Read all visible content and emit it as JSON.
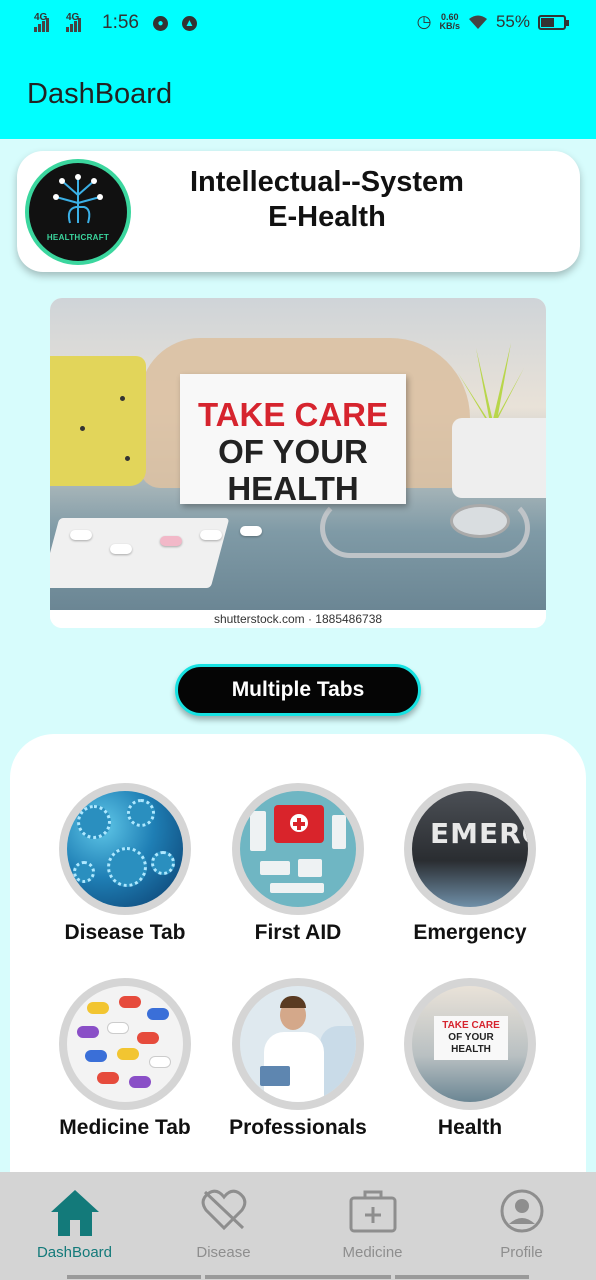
{
  "status_bar": {
    "network1": "4G",
    "network2": "4G",
    "time": "1:56",
    "speed_value": "0.60",
    "speed_unit": "KB/s",
    "battery": "55%",
    "battery_level": 0.55
  },
  "app_bar": {
    "title": "DashBoard"
  },
  "header": {
    "logo_text": "HEALTHCRAFT",
    "title_line1": "Intellectual--System",
    "title_line2": "E-Health"
  },
  "banner": {
    "sign_line1": "TAKE CARE",
    "sign_line2": "OF YOUR",
    "sign_line3": "HEALTH",
    "watermark": "shutterstock.com · 1885486738"
  },
  "tabs_button": {
    "label": "Multiple Tabs"
  },
  "tiles": [
    {
      "label": "Disease Tab",
      "icon": "virus-image"
    },
    {
      "label": "First AID",
      "icon": "first-aid-kit-image"
    },
    {
      "label": "Emergency",
      "icon": "emergency-sign-image",
      "image_text": "EMERGE"
    },
    {
      "label": "Medicine Tab",
      "icon": "pills-image"
    },
    {
      "label": "Professionals",
      "icon": "doctor-image"
    },
    {
      "label": "Health",
      "icon": "take-care-health-image",
      "image_text1": "TAKE CARE",
      "image_text2": "OF YOUR",
      "image_text3": "HEALTH"
    }
  ],
  "bottom_nav": {
    "items": [
      {
        "label": "DashBoard",
        "icon": "home-icon",
        "active": true
      },
      {
        "label": "Disease",
        "icon": "broken-heart-icon",
        "active": false
      },
      {
        "label": "Medicine",
        "icon": "medical-bag-icon",
        "active": false
      },
      {
        "label": "Profile",
        "icon": "user-icon",
        "active": false
      }
    ]
  },
  "colors": {
    "app_bar": "#00ffff",
    "background": "#d7fcfc",
    "active_nav": "#137a7a",
    "inactive_nav": "#8e8e8e",
    "pill_border": "#17e2e2"
  }
}
